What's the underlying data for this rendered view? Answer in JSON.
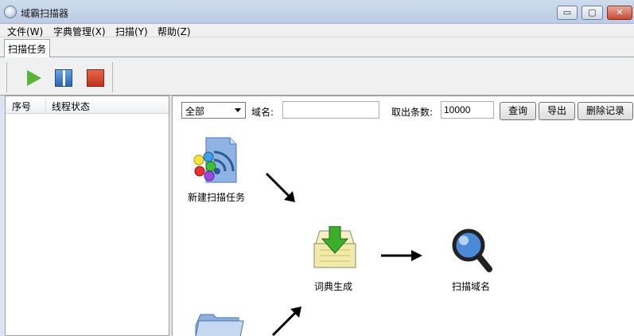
{
  "window": {
    "title": "域霸扫描器",
    "min_glyph": "▭",
    "max_glyph": "▢",
    "close_glyph": "✕"
  },
  "menu": [
    "文件(W)",
    "字典管理(X)",
    "扫描(Y)",
    "帮助(Z)"
  ],
  "tabs": [
    {
      "label": "扫描任务"
    }
  ],
  "toolbar": {
    "buttons": [
      "play-icon",
      "pause-icon",
      "stop-icon"
    ]
  },
  "task_list": {
    "columns": [
      "序号",
      "线程状态"
    ]
  },
  "filter": {
    "select_value": "全部",
    "domain_label": "域名:",
    "domain_value": "",
    "count_label": "取出条数:",
    "count_value": "10000",
    "query_label": "查询",
    "export_label": "导出",
    "delete_label": "删除记录"
  },
  "workflow": {
    "new_task": "新建扫描任务",
    "dict_gen": "词典生成",
    "scan_domain": "扫描域名"
  },
  "colors": {
    "play": "#5ab33a",
    "pause": "#2a66b4",
    "stop": "#c2331d",
    "window_bg": "#dbe4f0"
  }
}
